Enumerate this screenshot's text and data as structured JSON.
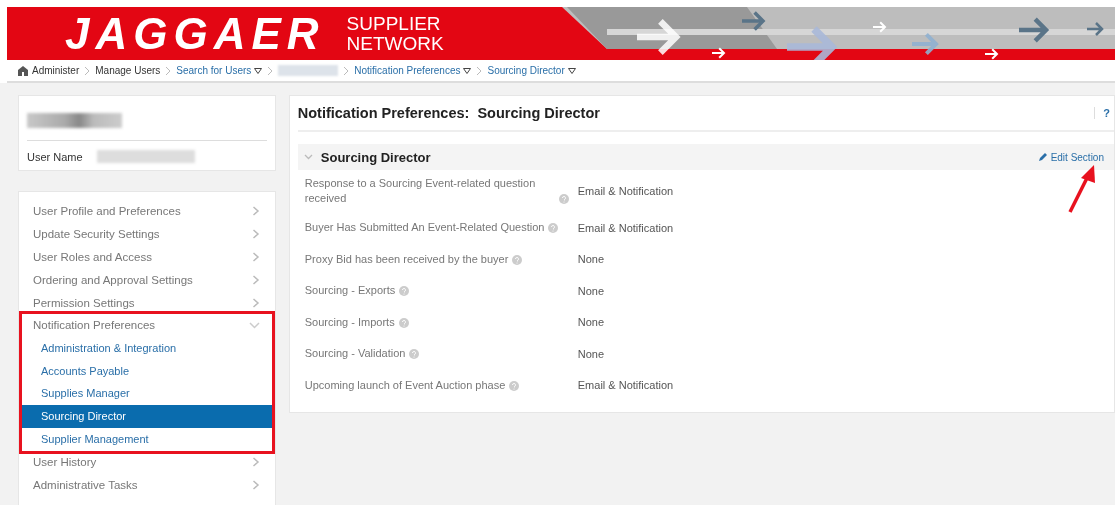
{
  "header": {
    "logo": "JAGGAER",
    "tagline": [
      "SUPPLIER",
      "NETWORK"
    ]
  },
  "breadcrumb": [
    {
      "label": "Administer",
      "kind": "root",
      "dropdown": false
    },
    {
      "label": "Manage Users",
      "kind": "plain",
      "dropdown": false
    },
    {
      "label": "Search for Users",
      "kind": "link",
      "dropdown": true
    },
    {
      "kind": "redacted"
    },
    {
      "label": "Notification Preferences",
      "kind": "link",
      "dropdown": true
    },
    {
      "label": "Sourcing Director",
      "kind": "link",
      "dropdown": true
    }
  ],
  "user_card": {
    "user_name_label": "User Name"
  },
  "nav": {
    "items": [
      {
        "label": "User Profile and Preferences",
        "expanded": false
      },
      {
        "label": "Update Security Settings",
        "expanded": false
      },
      {
        "label": "User Roles and Access",
        "expanded": false
      },
      {
        "label": "Ordering and Approval Settings",
        "expanded": false
      },
      {
        "label": "Permission Settings",
        "expanded": false
      },
      {
        "label": "Notification Preferences",
        "expanded": true,
        "highlighted": true,
        "children": [
          {
            "label": "Administration & Integration",
            "selected": false
          },
          {
            "label": "Accounts Payable",
            "selected": false
          },
          {
            "label": "Supplies Manager",
            "selected": false
          },
          {
            "label": "Sourcing Director",
            "selected": true
          },
          {
            "label": "Supplier Management",
            "selected": false
          }
        ]
      },
      {
        "label": "User History",
        "expanded": false
      },
      {
        "label": "Administrative Tasks",
        "expanded": false
      }
    ]
  },
  "main": {
    "title": "Notification Preferences:  Sourcing Director",
    "help": "?",
    "section": {
      "title": "Sourcing Director",
      "expanded": true,
      "edit_label": "Edit Section",
      "edit_arrow": true,
      "rows": [
        {
          "label": "Response to a Sourcing Event-related question received",
          "value": "Email & Notification"
        },
        {
          "label": "Buyer Has Submitted An Event-Related Question",
          "value": "Email & Notification"
        },
        {
          "label": "Proxy Bid has been received by the buyer",
          "value": "None"
        },
        {
          "label": "Sourcing - Exports",
          "value": "None"
        },
        {
          "label": "Sourcing - Imports",
          "value": "None"
        },
        {
          "label": "Sourcing - Validation",
          "value": "None"
        },
        {
          "label": "Upcoming launch of Event Auction phase",
          "value": "Email & Notification"
        }
      ]
    }
  }
}
